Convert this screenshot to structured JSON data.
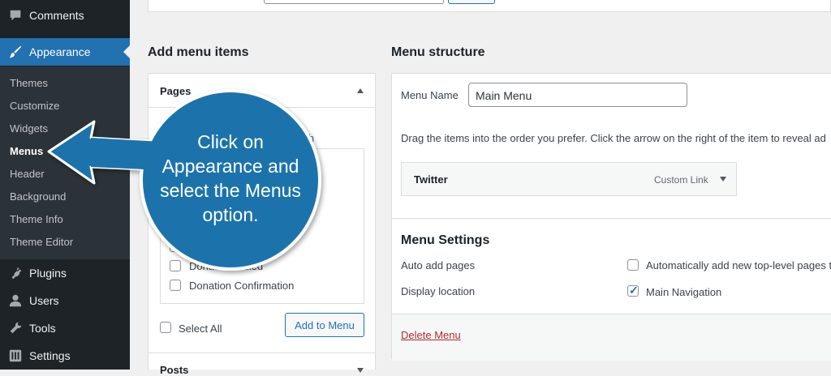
{
  "sidebar": {
    "top_items": [
      {
        "label": "Comments",
        "icon": "comment-icon"
      },
      {
        "label": "Appearance",
        "icon": "paintbrush-icon"
      },
      {
        "label": "Plugins",
        "icon": "plugin-icon"
      },
      {
        "label": "Users",
        "icon": "users-icon"
      },
      {
        "label": "Tools",
        "icon": "wrench-icon"
      },
      {
        "label": "Settings",
        "icon": "settings-icon"
      }
    ],
    "submenu": [
      "Themes",
      "Customize",
      "Widgets",
      "Menus",
      "Header",
      "Background",
      "Theme Info",
      "Theme Editor"
    ],
    "current_submenu": "Menus"
  },
  "add_items": {
    "title": "Add menu items",
    "pages_panel": {
      "title": "Pages",
      "search_link_fragment": "rch",
      "items": [
        "Donation Failed",
        "Donation Confirmation"
      ],
      "select_all": "Select All",
      "add_button": "Add to Menu"
    },
    "posts_panel_title": "Posts"
  },
  "structure": {
    "title": "Menu structure",
    "menu_name_label": "Menu Name",
    "menu_name_value": "Main Menu",
    "instructions": "Drag the items into the order you prefer. Click the arrow on the right of the item to reveal ad",
    "items": [
      {
        "title": "Twitter",
        "type": "Custom Link"
      }
    ],
    "settings": {
      "title": "Menu Settings",
      "auto_add_label": "Auto add pages",
      "auto_add_option": "Automatically add new top-level pages t",
      "auto_add_checked": false,
      "display_location_label": "Display location",
      "display_location_option": "Main Navigation",
      "display_location_checked": true
    },
    "delete_link": "Delete Menu"
  },
  "callout": {
    "lines": [
      "Click on",
      "Appearance and",
      "select the Menus",
      "option."
    ],
    "color": "#1e73ab"
  },
  "colors": {
    "sidebar_bg": "#1d2327",
    "submenu_bg": "#2c3338",
    "accent": "#2271b1",
    "delete": "#b32d2e"
  }
}
